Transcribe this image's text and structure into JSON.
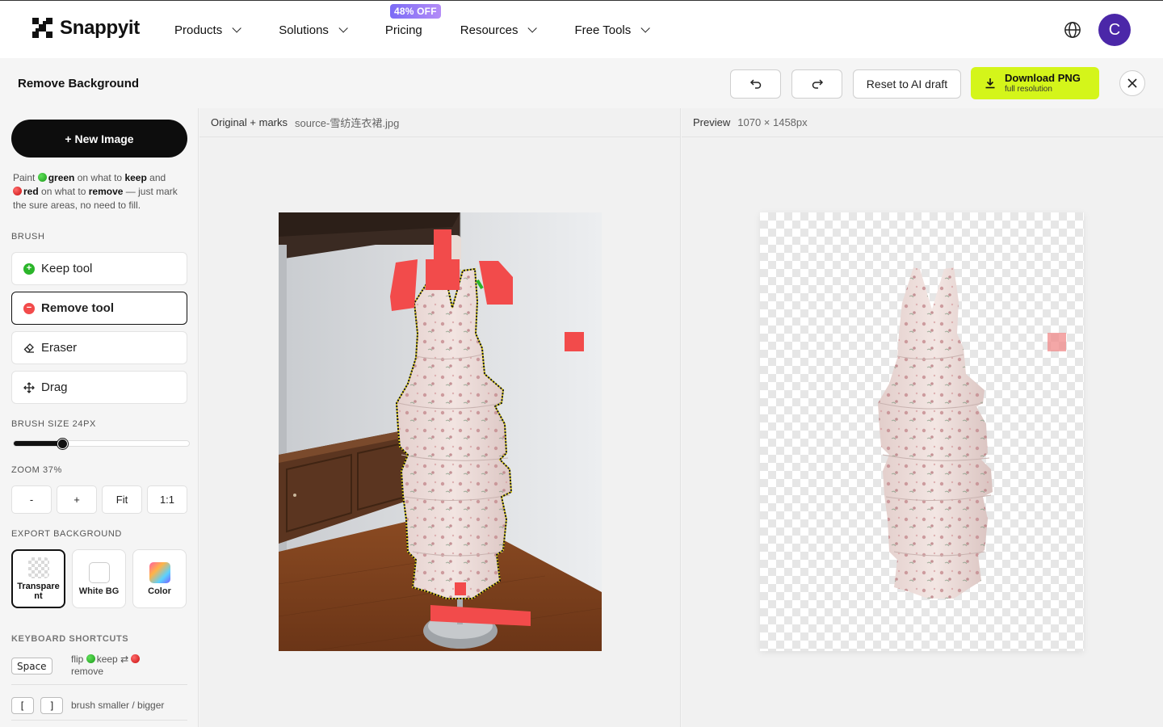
{
  "brand": {
    "name": "Snappyit"
  },
  "nav": {
    "items": [
      {
        "label": "Products",
        "has_dropdown": true
      },
      {
        "label": "Solutions",
        "has_dropdown": true
      },
      {
        "label": "Pricing",
        "has_dropdown": false
      },
      {
        "label": "Resources",
        "has_dropdown": true
      },
      {
        "label": "Free Tools",
        "has_dropdown": true
      }
    ],
    "promo_badge": "48% OFF",
    "globe_icon": "globe-icon",
    "avatar_initial": "C"
  },
  "toolbar": {
    "title": "Remove Background",
    "undo_icon": "undo-icon",
    "redo_icon": "redo-icon",
    "reset_label": "Reset to AI draft",
    "download_label": "Download PNG",
    "download_sublabel": "full resolution",
    "close_icon": "close-icon"
  },
  "sidebar": {
    "new_image_label": "+ New Image",
    "hint": {
      "paint": "Paint",
      "green": "green",
      "on_what_to": "on what to",
      "keep": "keep",
      "and": "and",
      "red": "red",
      "on_what_to_2": "on what to",
      "remove": "remove",
      "tail": "— just mark the sure areas, no need to fill."
    },
    "brush_label": "BRUSH",
    "tools": [
      {
        "label": "Keep tool",
        "icon": "plus-circle-icon",
        "active": false
      },
      {
        "label": "Remove tool",
        "icon": "minus-circle-icon",
        "active": true
      },
      {
        "label": "Eraser",
        "icon": "eraser-icon",
        "active": false
      },
      {
        "label": "Drag",
        "icon": "move-icon",
        "active": false
      }
    ],
    "brush_size_label": "BRUSH SIZE 24PX",
    "brush_size_value": 24,
    "brush_size_fraction": 0.28,
    "zoom_label": "ZOOM 37%",
    "zoom_buttons": [
      "-",
      "+",
      "Fit",
      "1:1"
    ],
    "export_bg_label": "EXPORT BACKGROUND",
    "export_options": [
      {
        "label": "Transparent",
        "active": true
      },
      {
        "label": "White BG",
        "active": false
      },
      {
        "label": "Color",
        "active": false
      }
    ],
    "shortcuts_label": "KEYBOARD SHORTCUTS",
    "shortcuts": [
      {
        "keys": [
          "Space"
        ],
        "desc_flip": "flip",
        "desc_keep": "keep",
        "desc_arrows": "⇄",
        "desc_remove": "remove"
      },
      {
        "keys": [
          "[",
          "]"
        ],
        "desc": "brush smaller / bigger"
      }
    ]
  },
  "left_panel": {
    "title": "Original + marks",
    "filename": "source-雪纺连衣裙.jpg"
  },
  "right_panel": {
    "title": "Preview",
    "dimensions": "1070 × 1458px"
  },
  "colors": {
    "accent_lime": "#d4f51a",
    "avatar_purple": "#4b27a8",
    "promo_purple": "#7b6cf6",
    "remove_red": "#f24b4b",
    "keep_green": "#2bb52a"
  }
}
